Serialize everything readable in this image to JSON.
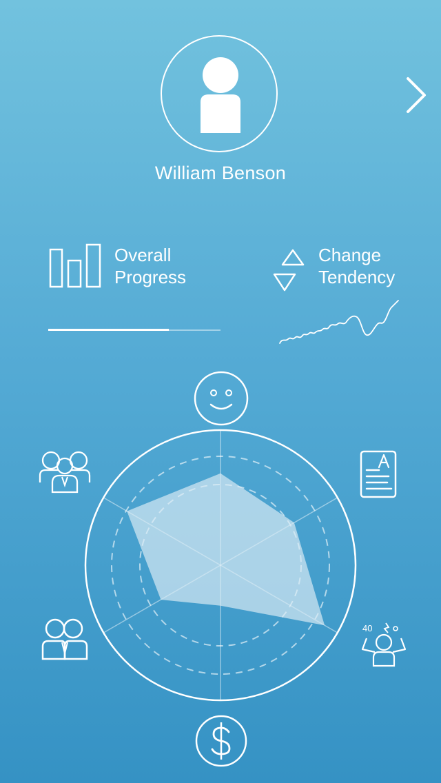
{
  "profile": {
    "name": "William Benson",
    "avatar_icon": "user-avatar-icon",
    "next_icon": "chevron-right-icon"
  },
  "stats": {
    "overall_progress": {
      "label_line1": "Overall",
      "label_line2": "Progress",
      "icon": "bar-chart-icon",
      "progress_fraction": 0.7
    },
    "change_tendency": {
      "label_line1": "Change",
      "label_line2": "Tendency",
      "icon": "up-down-triangles-icon"
    }
  },
  "radar": {
    "axes": [
      {
        "icon": "smiley-face-icon",
        "value": 0.68
      },
      {
        "icon": "graded-document-icon",
        "value": 0.63
      },
      {
        "icon": "stressed-person-icon",
        "value": 0.89
      },
      {
        "icon": "dollar-coin-icon",
        "value": 0.3
      },
      {
        "icon": "two-people-icon",
        "value": 0.51
      },
      {
        "icon": "group-of-people-icon",
        "value": 0.8
      }
    ]
  },
  "colors": {
    "background_top": "#72c2de",
    "background_bottom": "#3592c4",
    "foreground": "#ffffff"
  }
}
